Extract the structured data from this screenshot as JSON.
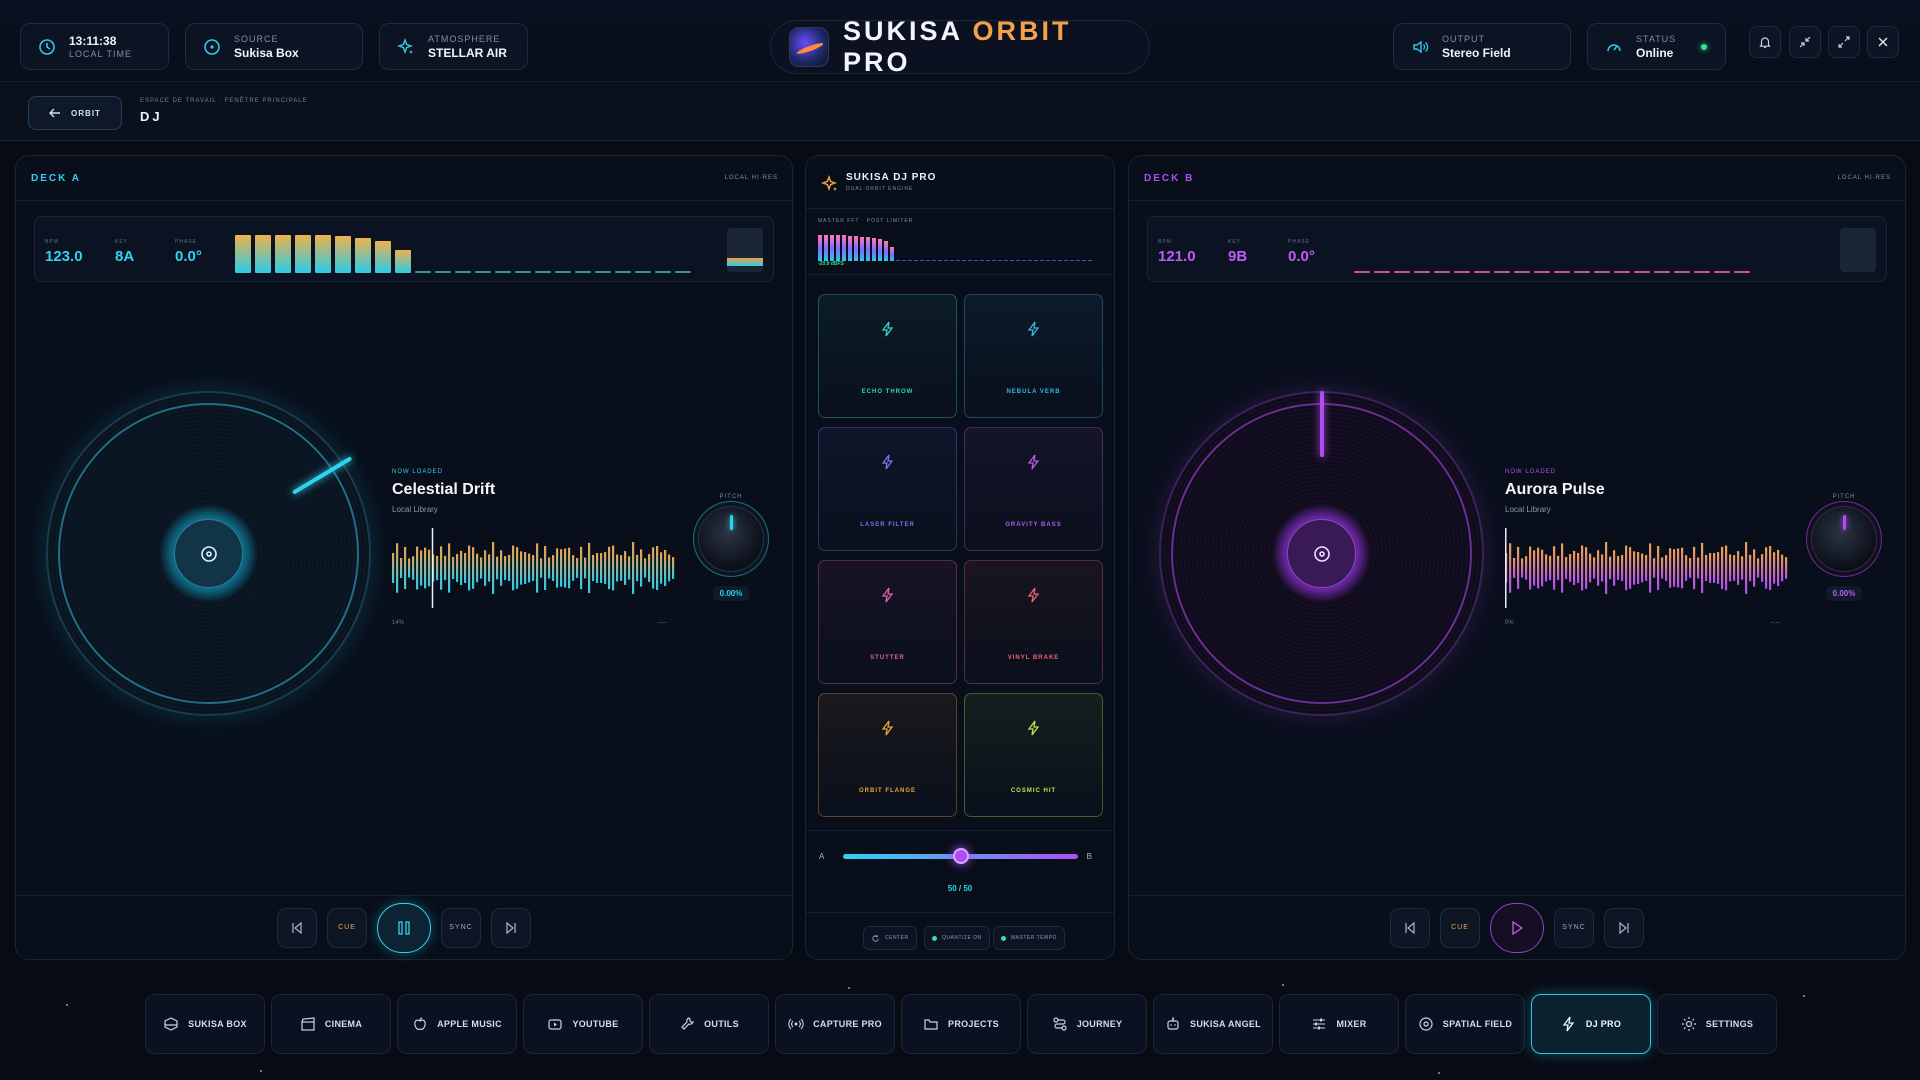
{
  "header": {
    "time": {
      "value": "13:11:38",
      "label": "LOCAL TIME",
      "icon": "clock-icon"
    },
    "source": {
      "label": "SOURCE",
      "value": "Sukisa Box",
      "icon": "disc-icon"
    },
    "atmosphere": {
      "label": "ATMOSPHERE",
      "value": "STELLAR AIR",
      "icon": "sparkle-icon"
    },
    "logo": {
      "word1": "SUKISA",
      "word2": "ORBIT",
      "word3": "PRO"
    },
    "output": {
      "label": "OUTPUT",
      "value": "Stereo Field",
      "icon": "speaker-icon"
    },
    "status": {
      "label": "STATUS",
      "value": "Online",
      "icon": "gauge-icon",
      "indicator_color": "#2fe08f"
    },
    "window_controls": [
      "bell-icon",
      "minimize-icon",
      "expand-icon",
      "close-icon"
    ]
  },
  "breadcrumb": {
    "back_label": "ORBIT",
    "path": "ESPACE DE TRAVAIL · FENÊTRE PRINCIPALE",
    "title": "DJ"
  },
  "deck_a": {
    "label": "DECK A",
    "source": "LOCAL HI-RES",
    "bpm_label": "BPM",
    "bpm": "123.0",
    "key_label": "KEY",
    "key": "8A",
    "phase_label": "PHASE",
    "phase": "0.0°",
    "now_loaded": "NOW LOADED",
    "title": "Celestial Drift",
    "library": "Local Library",
    "position": "14%",
    "remaining": "--:--",
    "pitch_label": "PITCH",
    "pitch": "0.00%",
    "accent": "#2ed3f0",
    "transport": {
      "cue": "CUE",
      "sync": "SYNC",
      "state": "playing"
    }
  },
  "deck_b": {
    "label": "DECK B",
    "source": "LOCAL HI-RES",
    "bpm_label": "BPM",
    "bpm": "121.0",
    "key_label": "KEY",
    "key": "9B",
    "phase_label": "PHASE",
    "phase": "0.0°",
    "now_loaded": "NOW LOADED",
    "title": "Aurora Pulse",
    "library": "Local Library",
    "position": "0%",
    "remaining": "--:--",
    "pitch_label": "PITCH",
    "pitch": "0.00%",
    "accent": "#b04df2",
    "transport": {
      "cue": "CUE",
      "sync": "SYNC",
      "state": "paused"
    }
  },
  "center": {
    "title": "SUKISA DJ PRO",
    "subtitle": "DUAL ORBIT ENGINE",
    "master_label": "MASTER FFT · POST LIMITER",
    "master_level": "-20.9 dBFS",
    "pads": [
      {
        "name": "ECHO THROW",
        "color": "#37d2c4"
      },
      {
        "name": "NEBULA VERB",
        "color": "#3fb4e8"
      },
      {
        "name": "LASER FILTER",
        "color": "#6f79f0"
      },
      {
        "name": "GRAVITY BASS",
        "color": "#b55de8"
      },
      {
        "name": "STUTTER",
        "color": "#e35db0"
      },
      {
        "name": "VINYL BRAKE",
        "color": "#f0607a"
      },
      {
        "name": "ORBIT FLANGE",
        "color": "#f2a03d"
      },
      {
        "name": "COSMIC HIT",
        "color": "#c3e24a"
      }
    ],
    "crossfader": {
      "left": "A",
      "right": "B",
      "value": "50 / 50",
      "position": 0.5
    },
    "chips": [
      {
        "label": "CENTER",
        "icon": "reset-icon"
      },
      {
        "label": "QUANTIZE ON",
        "dot": true
      },
      {
        "label": "MASTER TEMPO",
        "dot": true
      }
    ]
  },
  "nav": [
    {
      "label": "SUKISA BOX",
      "icon": "box-icon"
    },
    {
      "label": "CINEMA",
      "icon": "clapper-icon"
    },
    {
      "label": "APPLE MUSIC",
      "icon": "apple-icon"
    },
    {
      "label": "YOUTUBE",
      "icon": "youtube-icon"
    },
    {
      "label": "OUTILS",
      "icon": "wrench-icon"
    },
    {
      "label": "CAPTURE PRO",
      "icon": "broadcast-icon"
    },
    {
      "label": "PROJECTS",
      "icon": "folder-icon"
    },
    {
      "label": "JOURNEY",
      "icon": "route-icon"
    },
    {
      "label": "SUKISA ANGEL",
      "icon": "bot-icon"
    },
    {
      "label": "MIXER",
      "icon": "sliders-icon"
    },
    {
      "label": "SPATIAL FIELD",
      "icon": "orbit-icon"
    },
    {
      "label": "DJ PRO",
      "icon": "bolt-icon",
      "active": true
    },
    {
      "label": "SETTINGS",
      "icon": "gear-icon"
    }
  ]
}
